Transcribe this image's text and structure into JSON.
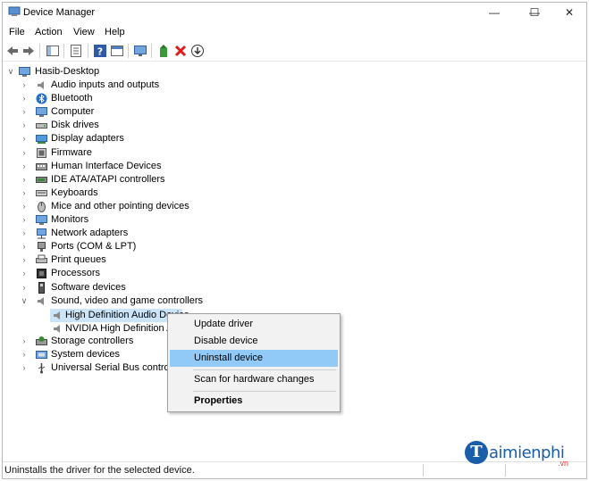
{
  "window": {
    "title": "Device Manager",
    "controls": {
      "minimize": "—",
      "maximize": "☐",
      "close": "✕"
    }
  },
  "menu": [
    "File",
    "Action",
    "View",
    "Help"
  ],
  "toolbar": {
    "icons": [
      "back-icon",
      "forward-icon",
      "show-hide-console-tree-icon",
      "properties-icon",
      "help-icon",
      "console-icon",
      "monitor-icon",
      "update-driver-icon",
      "uninstall-icon",
      "scan-hardware-icon"
    ]
  },
  "tree": {
    "root": "Hasib-Desktop",
    "categories": [
      {
        "label": "Audio inputs and outputs",
        "icon": "speaker-icon"
      },
      {
        "label": "Bluetooth",
        "icon": "bluetooth-icon"
      },
      {
        "label": "Computer",
        "icon": "computer-icon"
      },
      {
        "label": "Disk drives",
        "icon": "disk-drive-icon"
      },
      {
        "label": "Display adapters",
        "icon": "display-adapter-icon"
      },
      {
        "label": "Firmware",
        "icon": "firmware-icon"
      },
      {
        "label": "Human Interface Devices",
        "icon": "hid-icon"
      },
      {
        "label": "IDE ATA/ATAPI controllers",
        "icon": "ide-controller-icon"
      },
      {
        "label": "Keyboards",
        "icon": "keyboard-icon"
      },
      {
        "label": "Mice and other pointing devices",
        "icon": "mouse-icon"
      },
      {
        "label": "Monitors",
        "icon": "monitor-icon"
      },
      {
        "label": "Network adapters",
        "icon": "network-adapter-icon"
      },
      {
        "label": "Ports (COM & LPT)",
        "icon": "port-icon"
      },
      {
        "label": "Print queues",
        "icon": "printer-icon"
      },
      {
        "label": "Processors",
        "icon": "processor-icon"
      },
      {
        "label": "Software devices",
        "icon": "software-device-icon"
      },
      {
        "label": "Sound, video and game controllers",
        "icon": "speaker-icon",
        "expanded": true,
        "children": [
          "High Definition Audio Device",
          "NVIDIA High Definition Audio"
        ]
      },
      {
        "label": "Storage controllers",
        "icon": "storage-controller-icon"
      },
      {
        "label": "System devices",
        "icon": "system-device-icon"
      },
      {
        "label": "Universal Serial Bus controllers",
        "icon": "usb-icon"
      }
    ]
  },
  "context_menu": {
    "items": [
      "Update driver",
      "Disable device",
      "Uninstall device",
      "Scan for hardware changes",
      "Properties"
    ],
    "highlighted": "Uninstall device"
  },
  "status": {
    "text": "Uninstalls the driver for the selected device."
  },
  "watermark": {
    "brand": "aimienphi",
    "logo_letter": "T",
    "suffix": ".vn"
  },
  "colors": {
    "selection": "#cce4f7",
    "menu_highlight": "#91c9f7",
    "uninstall_red": "#e01b1b",
    "watermark_blue": "#1a5da8"
  }
}
